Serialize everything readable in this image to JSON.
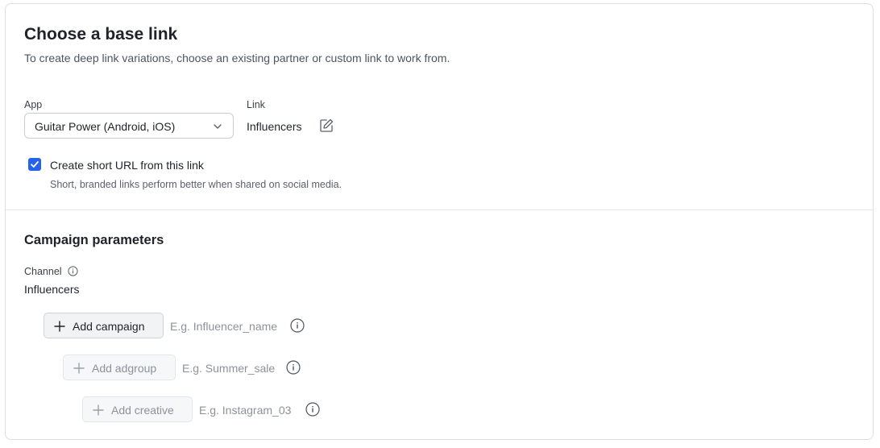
{
  "base_link": {
    "title": "Choose a base link",
    "subtitle": "To create deep link variations, choose an existing partner or custom link to work from.",
    "app_label": "App",
    "app_value": "Guitar Power (Android, iOS)",
    "link_label": "Link",
    "link_value": "Influencers",
    "short_url": {
      "checked": true,
      "label": "Create short URL from this link",
      "help": "Short, branded links perform better when shared on social media."
    }
  },
  "campaign": {
    "title": "Campaign parameters",
    "channel_label": "Channel",
    "channel_value": "Influencers",
    "add_campaign_label": "Add campaign",
    "campaign_placeholder": "E.g. Influencer_name",
    "add_adgroup_label": "Add adgroup",
    "adgroup_placeholder": "E.g. Summer_sale",
    "add_creative_label": "Add creative",
    "creative_placeholder": "E.g. Instagram_03"
  },
  "colors": {
    "accent": "#2563eb",
    "text_primary": "#1f2329",
    "text_muted": "#8c929b",
    "border": "#dcdfe4"
  },
  "icons": {
    "select": "chevron-down-icon",
    "link": "edit-icon",
    "checkbox": "check-icon",
    "channel_info": "info-icon",
    "add": "plus-icon"
  }
}
